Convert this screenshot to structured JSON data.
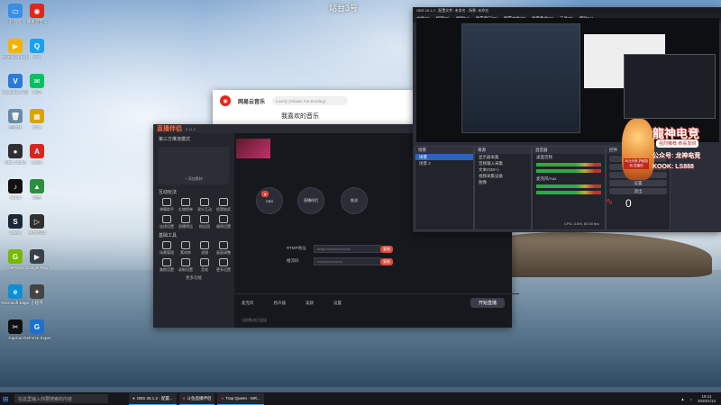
{
  "desktop": {
    "icons": [
      {
        "label": "此电脑",
        "color": "#3a8ee6",
        "glyph": "▭"
      },
      {
        "label": "PotPlayer 64 bit",
        "color": "#f5b300",
        "glyph": "▶"
      },
      {
        "label": "VirtualBox 录屏",
        "color": "#2b7bd6",
        "glyph": "V"
      },
      {
        "label": "回收站",
        "color": "#6b8aa8",
        "glyph": "🗑"
      },
      {
        "label": "OBS Studio",
        "color": "#302e31",
        "glyph": "●"
      },
      {
        "label": "TikTok",
        "color": "#111",
        "glyph": "♪"
      },
      {
        "label": "Steam",
        "color": "#1b2838",
        "glyph": "S"
      },
      {
        "label": "GeForce",
        "color": "#76b900",
        "glyph": "G"
      },
      {
        "label": "Microsoft Edge",
        "color": "#0c8fd6",
        "glyph": "e"
      },
      {
        "label": "CapCut",
        "color": "#111",
        "glyph": "✂"
      },
      {
        "label": "网易云音乐",
        "color": "#e2261c",
        "glyph": "◉"
      },
      {
        "label": "QQ",
        "color": "#1aa0f0",
        "glyph": "Q"
      },
      {
        "label": "微信",
        "color": "#07c160",
        "glyph": "✉"
      },
      {
        "label": "BOX",
        "color": "#d9a400",
        "glyph": "▦"
      },
      {
        "label": "Adobe",
        "color": "#d7261e",
        "glyph": "A"
      },
      {
        "label": "绿色",
        "color": "#2d8f3d",
        "glyph": "▲"
      },
      {
        "label": "视频剪辑",
        "color": "#303030",
        "glyph": "▷"
      },
      {
        "label": "Google Play",
        "color": "#3a4047",
        "glyph": "▶"
      },
      {
        "label": "小程序",
        "color": "#444",
        "glyph": "✦"
      },
      {
        "label": "GeForce Experience",
        "color": "#1e6fd0",
        "glyph": "G"
      }
    ],
    "top_labels": [
      "站台3号"
    ]
  },
  "netease": {
    "logo_text": "网易云音乐",
    "search_placeholder": "Lovely (Shawn Fat Bootleg)",
    "heading": "我喜欢的音乐"
  },
  "live_assistant": {
    "title": "直播伴侣",
    "version": "5.11.2",
    "account": "第三方推流模式",
    "sections": [
      "互动玩法",
      "基础工具"
    ],
    "interactive_tools": [
      "弹幕助手",
      "礼物榜单",
      "观众互动",
      "投票抽奖",
      "连线设置",
      "直播预告",
      "粉丝团",
      "福袋设置"
    ],
    "basic_tools": [
      "场景管理",
      "素材库",
      "滤镜",
      "画面调整",
      "美颜设置",
      "录制设置",
      "音效",
      "更多设置"
    ],
    "more_label": "更多功能",
    "add_scene_label": "+ 添加素材",
    "stream_url_label": "RTMP地址",
    "stream_key_label": "推流码",
    "stream_url_value": "rtmp://••••••••••••••••••",
    "stream_key_value": "••••••••••••••••••••",
    "copy_label": "复制",
    "node_labels": [
      "OBS",
      "直播伴侣",
      "推流"
    ],
    "bottom_controls": [
      "麦克风",
      "扬声器",
      "美颜",
      "美颜",
      "设置"
    ],
    "start_label": "开始直播",
    "footer_text": "当前推流已连接"
  },
  "obs": {
    "title": "OBS 25.1.2 - 配置文件: 未命名 - 场景: 未命名",
    "menu": [
      "文件(F)",
      "编辑(E)",
      "视图(V)",
      "停靠窗口(D)",
      "配置文件(P)",
      "场景集合(S)",
      "工具(T)",
      "帮助(H)"
    ],
    "scenes_header": "场景",
    "scenes": [
      "场景",
      "场景 2"
    ],
    "sources_header": "来源",
    "sources": [
      "显示器采集",
      "音频输入采集",
      "文本(GDI+)",
      "视频采集设备",
      "图像"
    ],
    "mixer_header": "混音器",
    "mixer_channels": [
      "桌面音频",
      "麦克风/Aux"
    ],
    "controls_header": "控件",
    "control_buttons": [
      "开始推流",
      "开始录制",
      "工作室模式",
      "设置",
      "退出"
    ],
    "status_text": "CPU: 3.8%, 60.00 fps"
  },
  "ad": {
    "title": "龍神电竞",
    "subtitle": "强烈推荐 恭喜发财",
    "line1": "公众号: 龙神电竞",
    "line2": "KOOK: LS888",
    "badge": "30元代练 护航陪玩 送福利"
  },
  "overlay": {
    "count": "0"
  },
  "taskbar": {
    "search_placeholder": "在这里输入你要搜索的内容",
    "apps": [
      "OBS 25.1.2 - 配置...",
      "斗鱼直播伴侣",
      "Trap Queen - MR..."
    ],
    "time": "19:11",
    "date": "2020/1/14"
  }
}
